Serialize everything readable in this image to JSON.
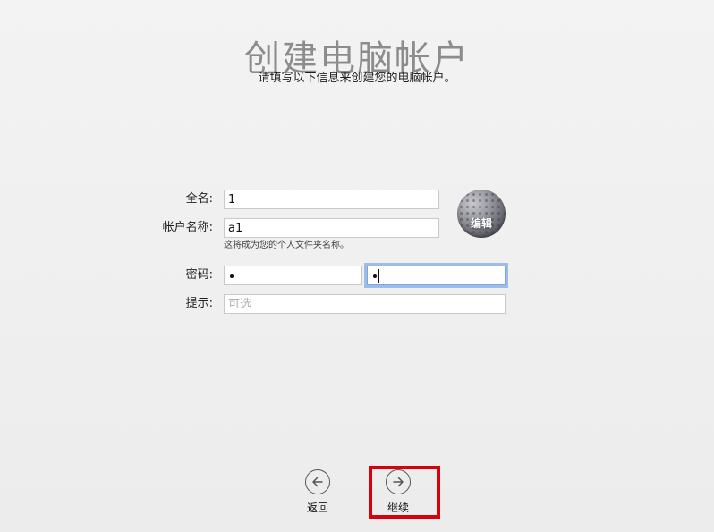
{
  "header": {
    "title": "创建电脑帐户",
    "subtitle": "请填写以下信息来创建您的电脑帐户。"
  },
  "form": {
    "full_name": {
      "label": "全名:",
      "value": "1"
    },
    "account_name": {
      "label": "帐户名称:",
      "value": "a1",
      "helper": "这将成为您的个人文件夹名称。"
    },
    "password": {
      "label": "密码:",
      "masked_length": 1
    },
    "verify_password": {
      "masked_length": 1,
      "focused": true
    },
    "hint": {
      "label": "提示:",
      "value": "",
      "placeholder": "可选"
    }
  },
  "avatar": {
    "icon": "golf-ball",
    "edit_label": "编辑"
  },
  "navigation": {
    "back": {
      "label": "返回",
      "icon": "arrow-left-circle-icon"
    },
    "continue": {
      "label": "继续",
      "icon": "arrow-right-circle-icon",
      "highlighted": true
    }
  },
  "colors": {
    "highlight_border": "#d9000e",
    "focus_ring": "#6ea0e6",
    "title_gray": "#8c8c8c"
  }
}
